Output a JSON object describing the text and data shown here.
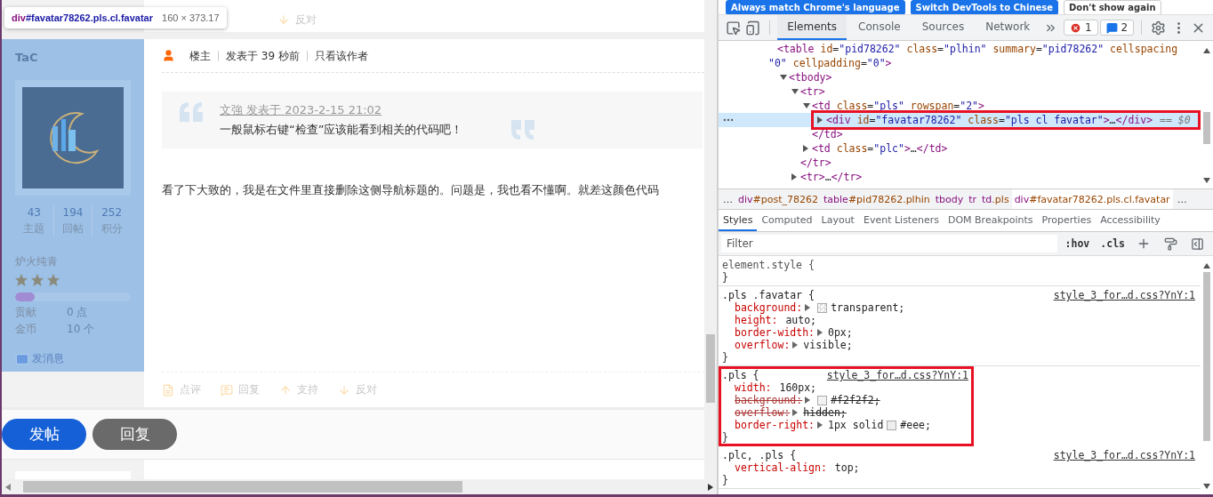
{
  "page": {
    "prev_actions": [
      {
        "kind": "down",
        "label": "反对"
      }
    ],
    "tooltip": {
      "tag": "div",
      "selector": "#favatar78262.pls.cl.favatar",
      "size": "160 × 373.17"
    },
    "author": {
      "highlighted": true,
      "name": "TaC",
      "stats": [
        {
          "value": "43",
          "label": "主题"
        },
        {
          "value": "194",
          "label": "回帖"
        },
        {
          "value": "252",
          "label": "积分"
        }
      ],
      "rank": "炉火纯青",
      "stars": 3,
      "level": 0.17,
      "credits": [
        {
          "label": "贡献",
          "value": "0 点"
        },
        {
          "label": "金币",
          "value": "10 个"
        }
      ],
      "message_link": "发消息"
    },
    "post": {
      "badge": "楼主",
      "time": "发表于 39 秒前",
      "author_only": "只看该作者",
      "quote": {
        "meta": "文強 发表于 2023-2-15 21:02",
        "text": "一般鼠标右键“检查”应该能看到相关的代码吧！"
      },
      "body": "看了下大致的，我是在文件里直接删除这侧导航标题的。问题是，我也看不懂啊。就差这颜色代码",
      "actions": [
        {
          "kind": "comment",
          "label": "点评"
        },
        {
          "kind": "reply",
          "label": "回复"
        },
        {
          "kind": "up",
          "label": "支持"
        },
        {
          "kind": "down",
          "label": "反对"
        }
      ]
    },
    "reply_buttons": [
      {
        "kind": "primary",
        "label": "发帖"
      },
      {
        "kind": "secondary",
        "label": "回复"
      }
    ]
  },
  "devtools": {
    "banner": [
      {
        "kind": "primary",
        "label": "Always match Chrome's language"
      },
      {
        "kind": "primary",
        "label": "Switch DevTools to Chinese"
      },
      {
        "kind": "plain",
        "label": "Don't show again"
      }
    ],
    "tabs": [
      {
        "label": "Elements",
        "selected": true
      },
      {
        "label": "Console",
        "selected": false
      },
      {
        "label": "Sources",
        "selected": false
      },
      {
        "label": "Network",
        "selected": false
      }
    ],
    "errors": "1",
    "messages": "2",
    "dom": [
      {
        "tag": "<table id=\"pid78262\" class=\"plhin\" summary=\"pid78262\" cellspacing",
        "wrap": "\"0\" cellpadding=\"0\">",
        "selected": false,
        "children": [
          {
            "tag": "<tbody>",
            "expanded": true,
            "selected": false,
            "children": [
              {
                "tag": "<tr>",
                "expanded": true,
                "selected": false,
                "close": "</tr>",
                "children": [
                  {
                    "tag": "<td class=\"pls\" rowspan=\"2\">",
                    "expanded": true,
                    "selected": false,
                    "close": "</td>",
                    "children": [
                      {
                        "tag": "<div id=\"favatar78262\" class=\"pls cl favatar\">",
                        "content": "…",
                        "close": "</div>",
                        "expanded": false,
                        "selected": true,
                        "highlighted": true,
                        "suffix": "== $0"
                      }
                    ]
                  },
                  {
                    "tag": "<td class=\"plc\">",
                    "content": "…",
                    "close": "</td>",
                    "expanded": false,
                    "selected": false
                  }
                ]
              },
              {
                "tag": "<tr>",
                "content": "…",
                "close": "</tr>",
                "expanded": false,
                "selected": false
              }
            ]
          }
        ]
      }
    ],
    "crumbs_more": "…",
    "breadcrumbs": [
      {
        "label": "div#post_78262",
        "selected": false
      },
      {
        "label": "table#pid78262.plhin",
        "selected": false
      },
      {
        "label": "tbody",
        "selected": false
      },
      {
        "label": "tr",
        "selected": false
      },
      {
        "label": "td.pls",
        "selected": false
      },
      {
        "label": "div#favatar78262.pls.cl.favatar",
        "selected": true
      }
    ],
    "style_tabs": [
      {
        "label": "Styles",
        "selected": true
      },
      {
        "label": "Computed",
        "selected": false
      },
      {
        "label": "Layout",
        "selected": false
      },
      {
        "label": "Event Listeners",
        "selected": false
      },
      {
        "label": "DOM Breakpoints",
        "selected": false
      },
      {
        "label": "Properties",
        "selected": false
      },
      {
        "label": "Accessibility",
        "selected": false
      }
    ],
    "filter": {
      "placeholder": "Filter",
      "hov": ":hov",
      "cls": ".cls"
    },
    "rules": [
      {
        "kind": "inline",
        "selector": "element.style {",
        "close": "}",
        "highlighted": false
      },
      {
        "kind": "sheet",
        "selector": ".pls .favatar {",
        "source": "style_3_for…d.css?YnY:1",
        "close": "}",
        "highlighted": false,
        "props": [
          {
            "name": "background:",
            "expandable": true,
            "swatch": {
              "kind": "transparent"
            },
            "value": "transparent;",
            "overridden": false
          },
          {
            "name": "height:",
            "expandable": false,
            "value": "auto;",
            "overridden": false
          },
          {
            "name": "border-width:",
            "expandable": true,
            "value": "0px;",
            "overridden": false
          },
          {
            "name": "overflow:",
            "expandable": true,
            "value": "visible;",
            "overridden": false
          }
        ]
      },
      {
        "kind": "sheet",
        "selector": ".pls {",
        "source": "style_3_for…d.css?YnY:1",
        "close": "}",
        "highlighted": true,
        "props": [
          {
            "name": "width:",
            "expandable": false,
            "value": "160px;",
            "overridden": false
          },
          {
            "name": "background:",
            "expandable": true,
            "swatch": {
              "kind": "solid",
              "color": "#f2f2f2"
            },
            "value": "#f2f2f2;",
            "overridden": true
          },
          {
            "name": "overflow:",
            "expandable": true,
            "value": "hidden;",
            "overridden": true
          },
          {
            "name": "border-right:",
            "expandable": true,
            "pre": "1px solid",
            "swatch": {
              "kind": "solid",
              "color": "#eeeeee"
            },
            "value": "#eee;",
            "overridden": false
          }
        ]
      },
      {
        "kind": "sheet",
        "selector": ".plc, .pls {",
        "source": "style_3_for…d.css?YnY:1",
        "close": "}",
        "highlighted": false,
        "props": [
          {
            "name": "vertical-align:",
            "expandable": false,
            "value": "top;",
            "overridden": false
          }
        ]
      }
    ]
  }
}
